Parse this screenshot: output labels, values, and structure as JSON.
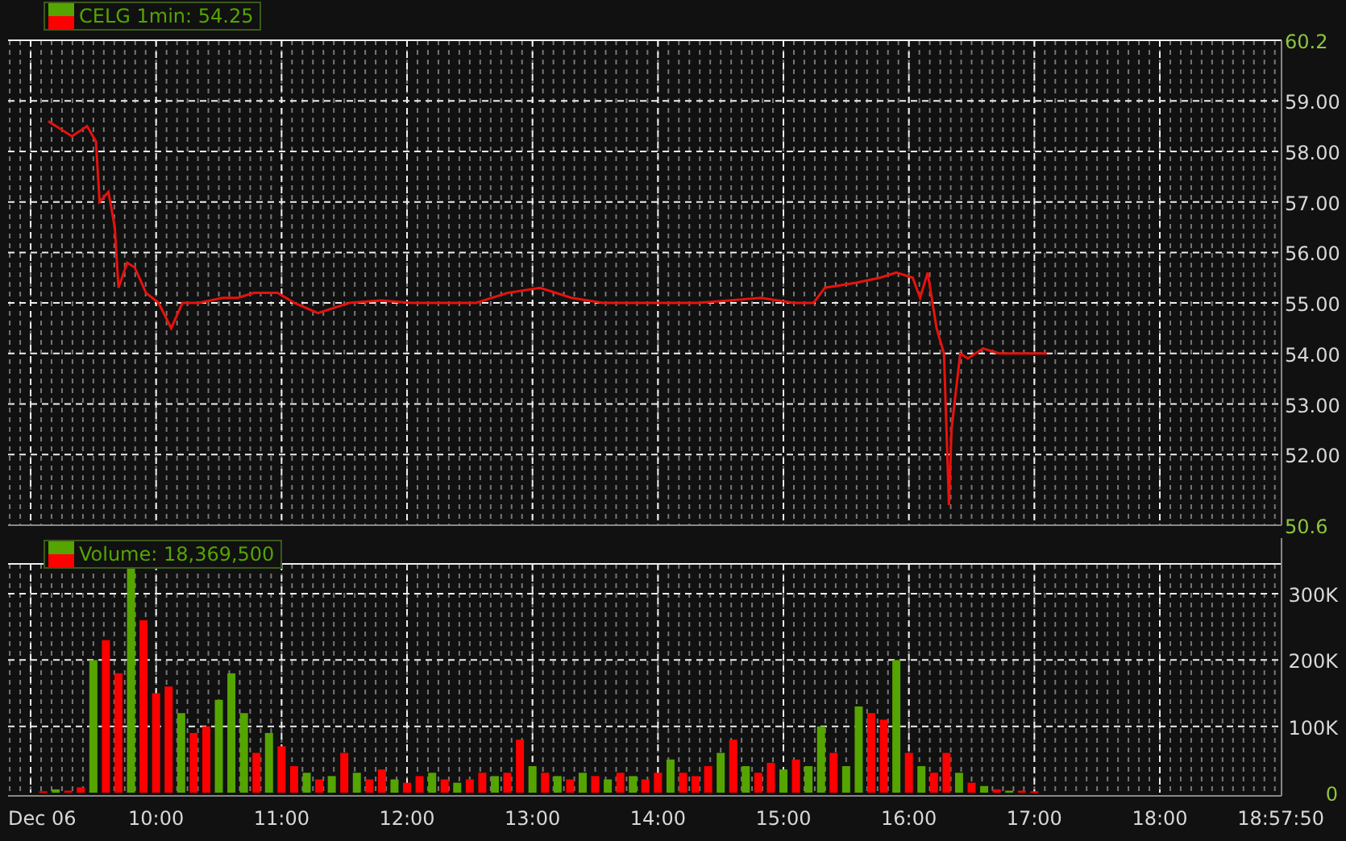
{
  "price_panel": {
    "chart_data": {
      "type": "line",
      "title": "CELG 1min: 54.25",
      "grid": true,
      "xlim": [
        8.82,
        18.97
      ],
      "ylim": [
        50.6,
        60.2
      ],
      "yticks": [
        {
          "value": 60.2,
          "label": "60.2"
        },
        {
          "value": 59,
          "label": "59.00"
        },
        {
          "value": 58,
          "label": "58.00"
        },
        {
          "value": 57,
          "label": "57.00"
        },
        {
          "value": 56,
          "label": "56.00"
        },
        {
          "value": 55,
          "label": "55.00"
        },
        {
          "value": 54,
          "label": "54.00"
        },
        {
          "value": 53,
          "label": "53.00"
        },
        {
          "value": 52,
          "label": "52.00"
        },
        {
          "value": 50.6,
          "label": "50.6"
        }
      ],
      "x": [
        9.14,
        9.33,
        9.45,
        9.52,
        9.55,
        9.62,
        9.67,
        9.7,
        9.77,
        9.83,
        9.92,
        10.02,
        10.12,
        10.21,
        10.34,
        10.53,
        10.65,
        10.78,
        10.97,
        11.1,
        11.29,
        11.54,
        11.79,
        12.04,
        12.3,
        12.55,
        12.8,
        13.06,
        13.31,
        13.56,
        13.81,
        14.07,
        14.32,
        14.57,
        14.82,
        15.08,
        15.24,
        15.33,
        15.58,
        15.77,
        15.9,
        16.03,
        16.09,
        16.15,
        16.22,
        16.28,
        16.32,
        16.34,
        16.41,
        16.47,
        16.53,
        16.59,
        16.72,
        16.85,
        17.1
      ],
      "series": [
        {
          "color": "#e8120c",
          "values": [
            58.6,
            58.3,
            58.5,
            58.2,
            57.0,
            57.2,
            56.5,
            55.3,
            55.8,
            55.7,
            55.2,
            55.0,
            54.5,
            55.0,
            55.0,
            55.1,
            55.1,
            55.2,
            55.2,
            55.0,
            54.8,
            55.0,
            55.05,
            55.0,
            55.0,
            55.0,
            55.2,
            55.3,
            55.1,
            55.0,
            55.0,
            55.0,
            55.0,
            55.05,
            55.1,
            55.0,
            55.0,
            55.3,
            55.4,
            55.5,
            55.6,
            55.5,
            55.1,
            55.6,
            54.5,
            54.0,
            51.0,
            52.5,
            54.0,
            53.9,
            54.0,
            54.1,
            54.0,
            54.0,
            54.0
          ]
        }
      ]
    }
  },
  "volume_panel": {
    "chart_data": {
      "type": "bar",
      "title": "Volume: 18,369,500",
      "stacked": true,
      "grid": true,
      "xlim": [
        8.82,
        18.97
      ],
      "ylim": [
        0,
        345000
      ],
      "yticks": [
        {
          "value": 300000,
          "label": "300K"
        },
        {
          "value": 200000,
          "label": "200K"
        },
        {
          "value": 100000,
          "label": "100K"
        },
        {
          "value": 0,
          "label": "0"
        }
      ],
      "xticks": [
        {
          "value": 8.82,
          "label": "Dec 06"
        },
        {
          "value": 10,
          "label": "10:00"
        },
        {
          "value": 11,
          "label": "11:00"
        },
        {
          "value": 12,
          "label": "12:00"
        },
        {
          "value": 13,
          "label": "13:00"
        },
        {
          "value": 14,
          "label": "14:00"
        },
        {
          "value": 15,
          "label": "15:00"
        },
        {
          "value": 16,
          "label": "16:00"
        },
        {
          "value": 17,
          "label": "17:00"
        },
        {
          "value": 18,
          "label": "18:00"
        },
        {
          "value": 18.964,
          "label": "18:57:50"
        }
      ],
      "x": [
        9.1,
        9.2,
        9.3,
        9.4,
        9.5,
        9.6,
        9.7,
        9.8,
        9.9,
        10.0,
        10.1,
        10.2,
        10.3,
        10.4,
        10.5,
        10.6,
        10.7,
        10.8,
        10.9,
        11.0,
        11.1,
        11.2,
        11.3,
        11.4,
        11.5,
        11.6,
        11.7,
        11.8,
        11.9,
        12.0,
        12.1,
        12.2,
        12.3,
        12.4,
        12.5,
        12.6,
        12.7,
        12.8,
        12.9,
        13.0,
        13.1,
        13.2,
        13.3,
        13.4,
        13.5,
        13.6,
        13.7,
        13.8,
        13.9,
        14.0,
        14.1,
        14.2,
        14.3,
        14.4,
        14.5,
        14.6,
        14.7,
        14.8,
        14.9,
        15.0,
        15.1,
        15.2,
        15.3,
        15.4,
        15.5,
        15.6,
        15.7,
        15.8,
        15.9,
        16.0,
        16.1,
        16.2,
        16.3,
        16.4,
        16.5,
        16.6,
        16.7,
        16.8,
        16.9,
        17.0
      ],
      "series": [
        {
          "color": "#55a500",
          "values": [
            null,
            5000,
            null,
            null,
            200000,
            null,
            null,
            340000,
            null,
            null,
            null,
            120000,
            null,
            null,
            140000,
            180000,
            120000,
            null,
            90000,
            null,
            null,
            30000,
            null,
            25000,
            null,
            30000,
            null,
            null,
            20000,
            null,
            null,
            30000,
            null,
            15000,
            null,
            null,
            25000,
            null,
            null,
            40000,
            null,
            25000,
            null,
            30000,
            null,
            20000,
            null,
            25000,
            null,
            null,
            50000,
            null,
            null,
            null,
            60000,
            null,
            40000,
            null,
            null,
            35000,
            null,
            40000,
            100000,
            null,
            40000,
            130000,
            null,
            null,
            200000,
            null,
            40000,
            null,
            null,
            30000,
            null,
            10000,
            null,
            3000,
            null,
            null
          ]
        },
        {
          "color": "#ff0000",
          "values": [
            2000,
            null,
            3000,
            8000,
            null,
            230000,
            180000,
            null,
            260000,
            150000,
            160000,
            null,
            90000,
            100000,
            null,
            null,
            null,
            60000,
            null,
            70000,
            40000,
            null,
            20000,
            null,
            60000,
            null,
            20000,
            35000,
            null,
            15000,
            25000,
            null,
            20000,
            null,
            20000,
            30000,
            null,
            30000,
            80000,
            null,
            30000,
            null,
            20000,
            null,
            25000,
            null,
            30000,
            null,
            20000,
            30000,
            null,
            30000,
            25000,
            40000,
            null,
            80000,
            null,
            30000,
            45000,
            null,
            50000,
            null,
            null,
            60000,
            null,
            null,
            120000,
            110000,
            null,
            60000,
            null,
            30000,
            60000,
            null,
            15000,
            null,
            5000,
            null,
            3000,
            2000
          ]
        }
      ]
    }
  }
}
